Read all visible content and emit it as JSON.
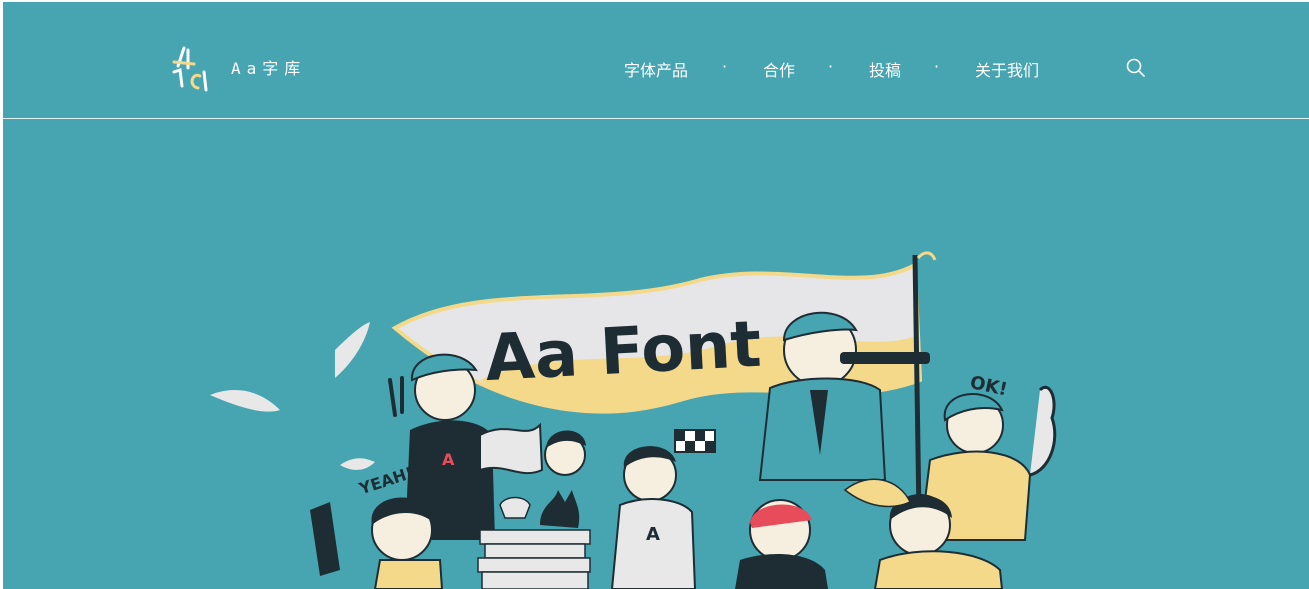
{
  "header": {
    "brand": "Aa字库",
    "logo_icon": "aa-logo-icon"
  },
  "nav": {
    "items": [
      {
        "label": "字体产品"
      },
      {
        "label": "合作"
      },
      {
        "label": "投稿"
      },
      {
        "label": "关于我们"
      }
    ],
    "separator": "·",
    "search_icon": "search-icon"
  },
  "hero": {
    "banner_text": "Aa Font",
    "yeah_text": "YEAH!",
    "ok_text": "OK!",
    "shirt_letter": "A"
  },
  "colors": {
    "background": "#46a5b1",
    "cream": "#f4d98a",
    "dark": "#1e2d33",
    "white": "#ffffff"
  }
}
